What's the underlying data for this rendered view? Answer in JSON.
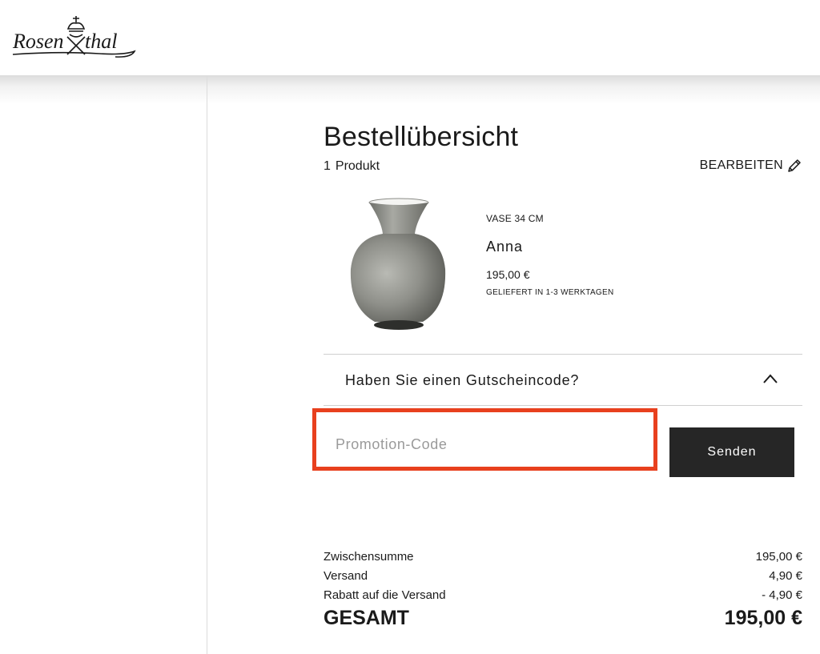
{
  "brand": {
    "name": "Rosenthal"
  },
  "order": {
    "title": "Bestellübersicht",
    "count": "1",
    "count_label": "Produkt",
    "edit_label": "BEARBEITEN"
  },
  "product": {
    "type": "VASE 34 CM",
    "name": "Anna",
    "price": "195,00 €",
    "delivery": "GELIEFERT IN 1-3 WERKTAGEN"
  },
  "coupon": {
    "question": "Haben Sie einen Gutscheincode?",
    "placeholder": "Promotion-Code",
    "value": "",
    "submit_label": "Senden",
    "expanded": true
  },
  "summary": {
    "subtotal_label": "Zwischensumme",
    "subtotal_value": "195,00 €",
    "shipping_label": "Versand",
    "shipping_value": "4,90 €",
    "discount_label": "Rabatt auf die Versand",
    "discount_value": "- 4,90 €",
    "total_label": "GESAMT",
    "total_value": "195,00 €"
  },
  "icons": {
    "edit": "pencil-icon",
    "toggle": "chevron-up-icon",
    "logo": "rosenthal-logo"
  },
  "colors": {
    "highlight": "#e8401e",
    "button_bg": "#262626",
    "text": "#1a1a1a",
    "vase_body": "#8d8e88"
  }
}
